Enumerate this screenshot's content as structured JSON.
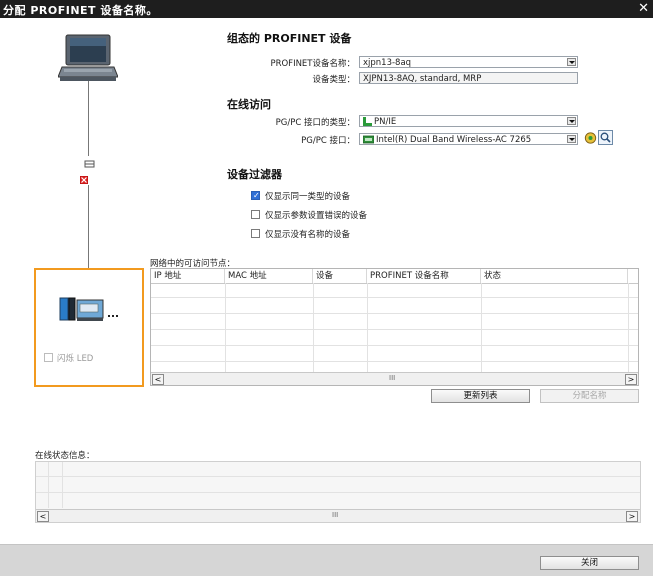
{
  "window": {
    "title": "分配 PROFINET 设备名称。",
    "close_glyph": "✕"
  },
  "configured": {
    "heading": "组态的 PROFINET 设备",
    "name_label": "PROFINET设备名称：",
    "name_value": "xjpn13-8aq",
    "type_label": "设备类型：",
    "type_value": "XJPN13-8AQ, standard, MRP"
  },
  "online": {
    "heading": "在线访问",
    "iface_type_label": "PG/PC 接口的类型：",
    "iface_type_value": "PN/IE",
    "iface_label": "PG/PC 接口：",
    "iface_value": "Intel(R) Dual Band Wireless-AC 7265"
  },
  "filter": {
    "heading": "设备过滤器",
    "options": [
      {
        "label": "仅显示同一类型的设备",
        "checked": true
      },
      {
        "label": "仅显示参数设置错误的设备",
        "checked": false
      },
      {
        "label": "仅显示没有名称的设备",
        "checked": false
      }
    ]
  },
  "nodes": {
    "caption": "网络中的可访问节点：",
    "columns": [
      "IP 地址",
      "MAC 地址",
      "设备",
      "PROFINET 设备名称",
      "状态"
    ],
    "rows": [],
    "scroll_mid": "III"
  },
  "buttons": {
    "refresh": "更新列表",
    "assign": "分配名称",
    "close": "关闭"
  },
  "flash": {
    "label": "闪烁 LED",
    "checked": false
  },
  "status_info": {
    "caption": "在线状态信息：",
    "scroll_mid": "III"
  }
}
